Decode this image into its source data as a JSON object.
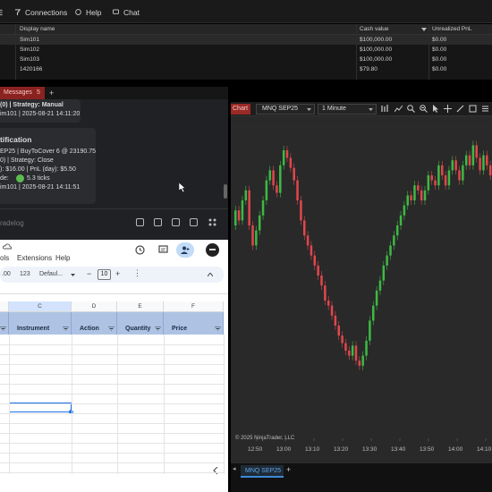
{
  "menu": {
    "connections_label": "Connections",
    "help_label": "Help",
    "chat_label": "Chat"
  },
  "accounts": {
    "columns": [
      "Display name",
      "Cash value",
      "Unrealized PnL"
    ],
    "rows": [
      {
        "name": "Sim101",
        "cash": "$100,000.00",
        "pnl": "$0.00"
      },
      {
        "name": "Sim102",
        "cash": "$100,000.00",
        "pnl": "$0.00"
      },
      {
        "name": "Sim103",
        "cash": "$100,000.00",
        "pnl": "$0.00"
      },
      {
        "name": "1420166",
        "cash": "$79.80",
        "pnl": "$0.00"
      }
    ]
  },
  "messages_tab": {
    "label": "Messages",
    "count": "5",
    "add_label": "+"
  },
  "messages": {
    "card1_line1": "(0) | Strategy: Manual",
    "card1_line2": "im101 | 2025-08-21 14:11:20",
    "card2_title": "tification",
    "card2_lines": [
      "EP25 | BuyToCover 6 @ 23190.75",
      "0) | Strategy: Close",
      "): $16.00 | PnL (day): $5.50",
      "de:",
      "5.3 ticks",
      "im101 | 2025-08-21 14:11:51"
    ],
    "bottom_label": "radelog"
  },
  "sheets": {
    "menu_tools": "ols",
    "menu_extensions": "Extensions",
    "menu_help": "Help",
    "toolbar_123": "123",
    "font_label": "Defaul...",
    "font_size": "10",
    "columns": [
      "C",
      "D",
      "E",
      "F"
    ],
    "headers": [
      "Instrument",
      "Action",
      "Quantity",
      "Price"
    ]
  },
  "chart": {
    "tab_label": "Chart",
    "instrument": "MNQ SEP25",
    "interval": "1 Minute",
    "copyright": "© 2025 NinjaTrader, LLC",
    "bottom_tab": "MNQ SEP25",
    "add_tab": "+",
    "x_ticks": [
      "12:50",
      "13:00",
      "13:10",
      "13:20",
      "13:30",
      "13:40",
      "13:50",
      "14:00",
      "14:10"
    ],
    "colors": {
      "up": "#3db944",
      "down": "#e0474c",
      "background": "#292929"
    }
  },
  "chart_data": {
    "type": "candlestick",
    "title": "MNQ SEP25",
    "x_ticks": [
      "12:50",
      "13:00",
      "13:10",
      "13:20",
      "13:30",
      "13:40",
      "13:50",
      "14:00",
      "14:10"
    ],
    "closes": [
      66,
      62,
      70,
      74,
      60,
      52,
      58,
      64,
      70,
      78,
      82,
      76,
      73,
      84,
      90,
      87,
      83,
      78,
      70,
      62,
      56,
      52,
      48,
      44,
      40,
      36,
      30,
      28,
      24,
      20,
      16,
      13,
      10,
      8,
      12,
      6,
      4,
      8,
      14,
      22,
      28,
      34,
      38,
      44,
      48,
      52,
      56,
      60,
      64,
      68,
      72,
      70,
      76,
      74,
      70,
      74,
      80,
      78,
      76,
      84,
      80,
      76,
      82,
      86,
      82,
      78,
      84,
      88,
      84,
      92,
      87,
      82,
      88,
      84,
      80,
      74
    ],
    "opens": [
      60,
      66,
      62,
      70,
      74,
      60,
      52,
      58,
      64,
      70,
      78,
      82,
      76,
      73,
      84,
      90,
      87,
      83,
      78,
      70,
      62,
      56,
      52,
      48,
      44,
      40,
      36,
      30,
      28,
      24,
      20,
      16,
      13,
      10,
      8,
      12,
      6,
      4,
      8,
      14,
      22,
      28,
      34,
      38,
      44,
      48,
      52,
      56,
      60,
      64,
      68,
      72,
      70,
      76,
      74,
      70,
      74,
      80,
      78,
      76,
      84,
      80,
      76,
      82,
      86,
      82,
      78,
      84,
      88,
      84,
      92,
      87,
      82,
      88,
      84,
      80
    ]
  }
}
